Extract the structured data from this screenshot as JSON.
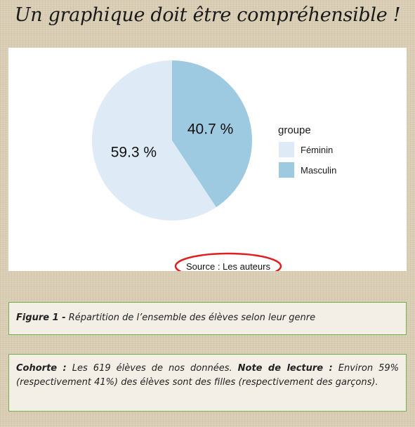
{
  "page": {
    "title": "Un graphique doit être compréhensible !"
  },
  "chart_data": {
    "type": "pie",
    "categories": [
      "Féminin",
      "Masculin"
    ],
    "values": [
      59.3,
      40.7
    ],
    "slice_labels": [
      "59.3 %",
      "40.7 %"
    ],
    "colors": [
      "#deebf7",
      "#9ecae1"
    ],
    "legend": {
      "title": "groupe",
      "placement": "right"
    },
    "source": "Source : Les auteurs",
    "source_highlight_color": "#e02020"
  },
  "caption": {
    "figure_label": "Figure 1 -",
    "figure_text": " Répartition de l’ensemble des élèves selon leur genre"
  },
  "note": {
    "cohort_label": "Cohorte :",
    "cohort_text": " Les 619 élèves de nos données. ",
    "reading_label": "Note de lecture :",
    "reading_text": " Environ 59% (respectivement 41%) des élèves sont des filles (respectivement des garçons)."
  }
}
